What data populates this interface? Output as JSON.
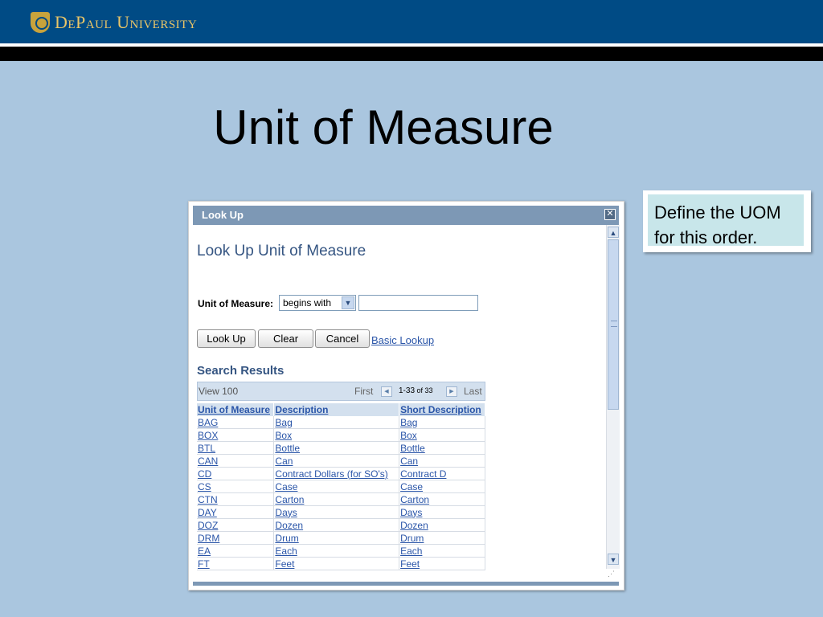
{
  "header": {
    "logo_text": "DePaul University"
  },
  "slide": {
    "title": "Unit of Measure"
  },
  "callout": {
    "line1": "Define the UOM",
    "line2": "for this order."
  },
  "window": {
    "title": "Look Up",
    "close_glyph": "✕",
    "heading": "Look Up Unit of Measure",
    "field_label": "Unit of Measure:",
    "operator_value": "begins with",
    "search_value": "",
    "buttons": {
      "lookup": "Look Up",
      "clear": "Clear",
      "cancel": "Cancel"
    },
    "basic_lookup_link": "Basic Lookup",
    "results_heading": "Search Results",
    "nav": {
      "view": "View 100",
      "first": "First",
      "range_main": "1-33",
      "range_suffix": " of 33",
      "last": "Last"
    },
    "columns": [
      "Unit of Measure",
      "Description",
      "Short Description"
    ],
    "rows": [
      [
        "BAG",
        "Bag",
        "Bag"
      ],
      [
        "BOX",
        "Box",
        "Box"
      ],
      [
        "BTL",
        "Bottle",
        "Bottle"
      ],
      [
        "CAN",
        "Can",
        "Can"
      ],
      [
        "CD",
        "Contract Dollars (for SO's)",
        "Contract D"
      ],
      [
        "CS",
        "Case",
        "Case"
      ],
      [
        "CTN",
        "Carton",
        "Carton"
      ],
      [
        "DAY",
        "Days",
        "Days"
      ],
      [
        "DOZ",
        "Dozen",
        "Dozen"
      ],
      [
        "DRM",
        "Drum",
        "Drum"
      ],
      [
        "EA",
        "Each",
        "Each"
      ],
      [
        "FT",
        "Feet",
        "Feet"
      ]
    ]
  },
  "colors": {
    "header_blue": "#004b85",
    "background": "#aac6df",
    "link_blue": "#2a55a8",
    "title_blue": "#355582",
    "callout_fill": "#c8e6ea"
  }
}
